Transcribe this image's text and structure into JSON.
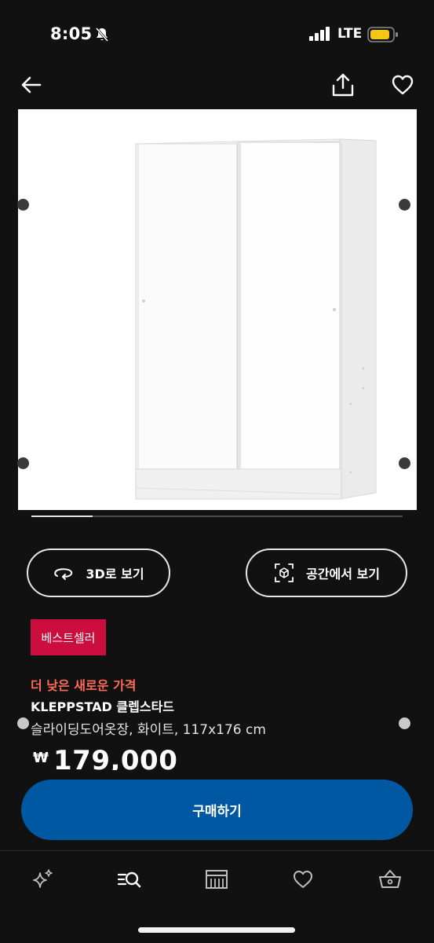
{
  "status_bar": {
    "time": "8:05",
    "network": "LTE",
    "icons": [
      "bell-slash-icon",
      "signal-icon",
      "battery-icon"
    ],
    "battery_color": "#f5c518"
  },
  "nav": {
    "icons": [
      "back-arrow-icon",
      "share-icon",
      "heart-icon"
    ]
  },
  "gallery": {
    "progress": 0.165
  },
  "actions": {
    "view_3d_label": "3D로 보기",
    "view_in_space_label": "공간에서 보기"
  },
  "product": {
    "badge": "베스트셀러",
    "promo": "더 낮은 새로운 가격",
    "name": "KLEPPSTAD 클렙스타드",
    "description": "슬라이딩도어옷장, 화이트, 117x176 cm",
    "currency": "₩",
    "price": "179,000"
  },
  "buy_button": {
    "label": "구매하기",
    "color": "#0058a3"
  },
  "tab_bar": {
    "tabs": [
      "sparkle-icon",
      "search-list-icon",
      "store-icon",
      "heart-icon",
      "basket-icon"
    ]
  },
  "colors": {
    "background": "#111111",
    "badge": "#cc0e3f",
    "promo": "#ff6b5a"
  }
}
